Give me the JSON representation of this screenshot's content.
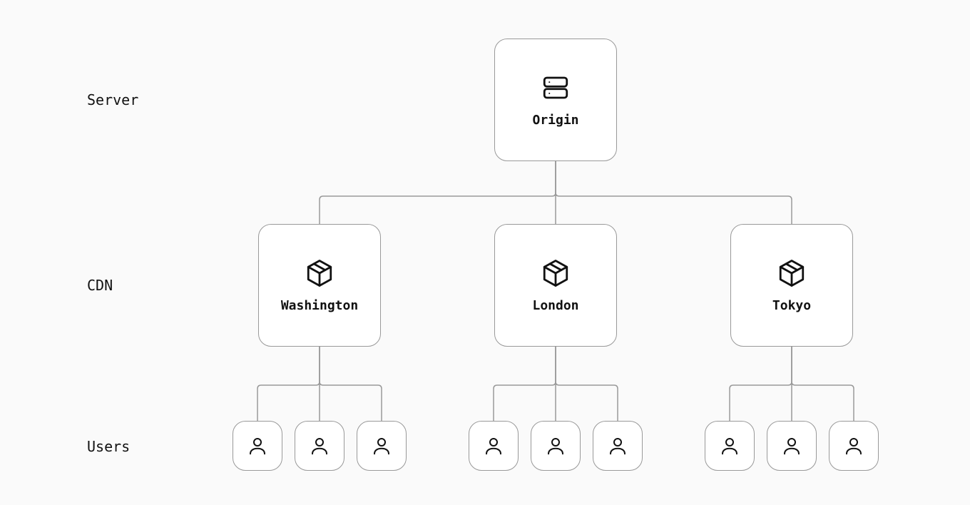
{
  "labels": {
    "server": "Server",
    "cdn": "CDN",
    "users": "Users"
  },
  "origin": {
    "label": "Origin"
  },
  "cdn_nodes": [
    {
      "label": "Washington"
    },
    {
      "label": "London"
    },
    {
      "label": "Tokyo"
    }
  ],
  "users_per_cdn": 3
}
